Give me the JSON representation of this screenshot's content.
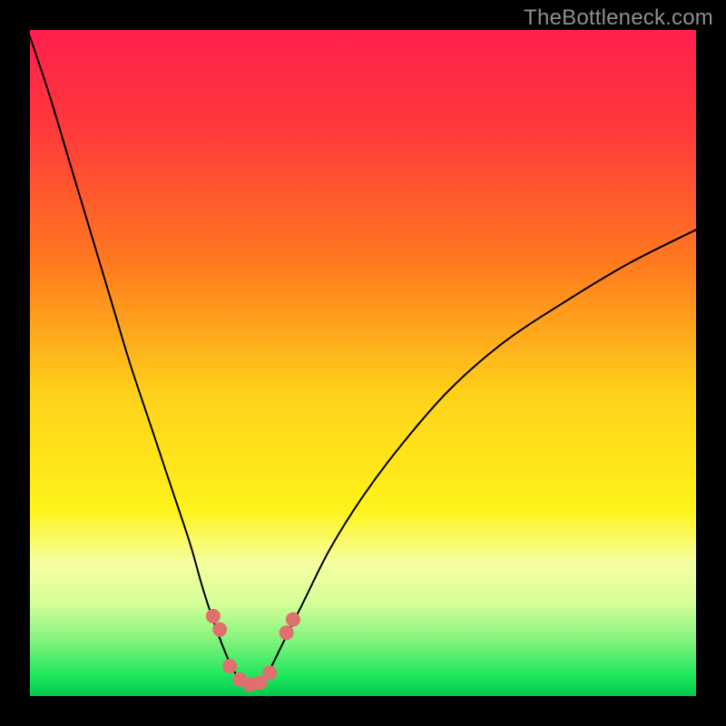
{
  "watermark": "TheBottleneck.com",
  "chart_data": {
    "type": "line",
    "title": "",
    "xlabel": "",
    "ylabel": "",
    "xlim": [
      0,
      100
    ],
    "ylim": [
      0,
      100
    ],
    "background_gradient_stops": [
      {
        "pos": 0.0,
        "color": "#ff1f4d"
      },
      {
        "pos": 0.15,
        "color": "#ff3a3a"
      },
      {
        "pos": 0.35,
        "color": "#ff7a1f"
      },
      {
        "pos": 0.55,
        "color": "#ffd21a"
      },
      {
        "pos": 0.72,
        "color": "#fff31a"
      },
      {
        "pos": 0.8,
        "color": "#f6ffa1"
      },
      {
        "pos": 0.86,
        "color": "#d6ff99"
      },
      {
        "pos": 0.92,
        "color": "#7cf37a"
      },
      {
        "pos": 0.97,
        "color": "#1de65c"
      },
      {
        "pos": 1.0,
        "color": "#03c94b"
      }
    ],
    "series": [
      {
        "name": "bottleneck-curve",
        "stroke": "#000000",
        "stroke_width": 2.0,
        "x": [
          0,
          3,
          6,
          9,
          12,
          15,
          18,
          21,
          24,
          26,
          28,
          30,
          31.5,
          33,
          34.5,
          36,
          38,
          41,
          45,
          50,
          56,
          63,
          71,
          80,
          90,
          100
        ],
        "values": [
          99,
          90,
          80,
          70,
          60,
          50,
          41,
          32,
          23,
          16,
          10,
          5,
          2.5,
          1.5,
          2,
          4,
          8,
          14,
          22,
          30,
          38,
          46,
          53,
          59,
          65,
          70
        ]
      }
    ],
    "markers": {
      "name": "highlight-points",
      "color": "#e06f6f",
      "radius": 8,
      "points": [
        {
          "x": 27.5,
          "y": 12
        },
        {
          "x": 28.5,
          "y": 10
        },
        {
          "x": 30.0,
          "y": 4.5
        },
        {
          "x": 31.5,
          "y": 2.5
        },
        {
          "x": 33.0,
          "y": 1.7
        },
        {
          "x": 34.5,
          "y": 2.0
        },
        {
          "x": 36.0,
          "y": 3.5
        },
        {
          "x": 38.5,
          "y": 9.5
        },
        {
          "x": 39.5,
          "y": 11.5
        }
      ]
    }
  }
}
